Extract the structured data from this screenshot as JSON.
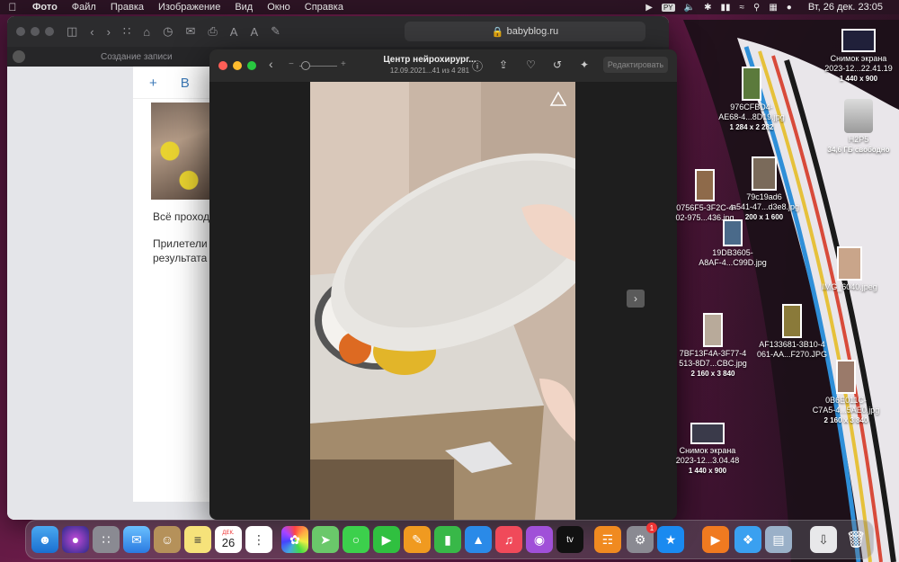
{
  "menubar": {
    "app": "Фото",
    "menus": [
      "Файл",
      "Правка",
      "Изображение",
      "Вид",
      "Окно",
      "Справка"
    ],
    "keyboard": "PY",
    "datetime": "Вт, 26 дек.  23:05"
  },
  "safari": {
    "url": "babyblog.ru",
    "tab_title": "Создание записи",
    "editor_plus": "+",
    "editor_b": "B",
    "text_line1": "Всё проход",
    "text_line2": "Прилетели м",
    "text_line3": "результата"
  },
  "viewer": {
    "title": "Центр нейрохирург...",
    "subtitle": "12.09.2021...41 из 4 281",
    "zoom_minus": "−",
    "zoom_plus": "+",
    "edit_label": "Редактировать",
    "zoom_level": 0.1
  },
  "desktop": [
    {
      "name": "Снимок экрана\n2023-12...22.41.19",
      "dims": "1 440 x 900"
    },
    {
      "name": "Н2Р5",
      "dims": "34,6 ГБ свободно"
    },
    {
      "name": "976CFBD4-\nAE68-4...8D19.jpg",
      "dims": "1 284 x 2 282"
    },
    {
      "name": "79c19ad6\n-a541-47...d3e8.jpg",
      "dims": "200 x 1 600"
    },
    {
      "name": "0756F5-3F2C-4\n02-975...436.jpg",
      "dims": ""
    },
    {
      "name": "19DB3605-\nA8AF-4...C99D.jpg",
      "dims": ""
    },
    {
      "name": "IMG_6040.jpeg",
      "dims": ""
    },
    {
      "name": "7BF13F4A-3F77-4\n513-8D7...CBC.jpg",
      "dims": "2 160 x 3 840"
    },
    {
      "name": "AF133681-3B10-4\n061-AA...F270.JPG",
      "dims": ""
    },
    {
      "name": "0B6E011C-\nC7A5-4...5AE0.jpg",
      "dims": "2 160 x 3 840"
    },
    {
      "name": "Снимок экрана\n2023-12...3.04.48",
      "dims": "1 440 x 900"
    }
  ],
  "dock": {
    "calendar_month": "ДЕК.",
    "calendar_day": "26",
    "tv_label": "tv",
    "settings_badge": "1"
  }
}
